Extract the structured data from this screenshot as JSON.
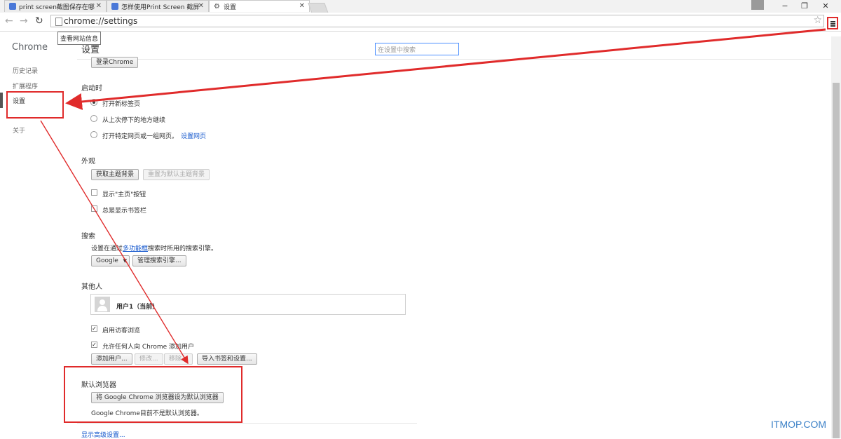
{
  "tabs": [
    {
      "title": "print screen截图保存在哪",
      "active": false
    },
    {
      "title": "怎样使用Print Screen 截屏",
      "active": false
    },
    {
      "title": "设置",
      "active": true
    }
  ],
  "window_controls": {
    "minimize": "−",
    "restore": "❐",
    "close": "✕"
  },
  "toolbar": {
    "back_icon": "back-arrow-icon",
    "forward_icon": "forward-arrow-icon",
    "reload_icon": "reload-icon",
    "url": "chrome://settings",
    "tooltip": "查看网站信息"
  },
  "sidebar": {
    "brand": "Chrome",
    "items": [
      {
        "label": "历史记录"
      },
      {
        "label": "扩展程序"
      },
      {
        "label": "设置",
        "selected": true
      },
      {
        "label": "关于"
      }
    ]
  },
  "header": {
    "title": "设置",
    "search_placeholder": "在设置中搜索"
  },
  "signin": {
    "button": "登录Chrome"
  },
  "startup": {
    "heading": "启动时",
    "options": [
      {
        "label": "打开新标签页",
        "selected": true
      },
      {
        "label": "从上次停下的地方继续",
        "selected": false
      },
      {
        "label": "打开特定网页或一组网页。",
        "link": "设置网页",
        "selected": false
      }
    ]
  },
  "appearance": {
    "heading": "外观",
    "get_themes": "获取主题背景",
    "reset_theme": "重置为默认主题背景",
    "show_home": "显示\"主页\"按钮",
    "show_bookmarks": "总是显示书签栏"
  },
  "search": {
    "heading": "搜索",
    "desc_before": "设置在通过",
    "desc_link": "多功能框",
    "desc_after": "搜索时所用的搜索引擎。",
    "engine": "Google",
    "manage": "管理搜索引擎..."
  },
  "people": {
    "heading": "其他人",
    "profile_name": "用户1（当前）",
    "guest_browsing": "启用访客浏览",
    "allow_add": "允许任何人向 Chrome 添加用户",
    "add_user": "添加用户...",
    "edit": "修改...",
    "remove": "移除...",
    "import": "导入书签和设置..."
  },
  "default_browser": {
    "heading": "默认浏览器",
    "make_default": "将 Google Chrome 浏览器设为默认浏览器",
    "status": "Google Chrome目前不是默认浏览器。"
  },
  "advanced_link": "显示高级设置...",
  "watermark": "ITMOP.COM",
  "colors": {
    "annotation_red": "#e02b2b",
    "link_blue": "#1155cc",
    "focus_blue": "#4d90fe"
  }
}
